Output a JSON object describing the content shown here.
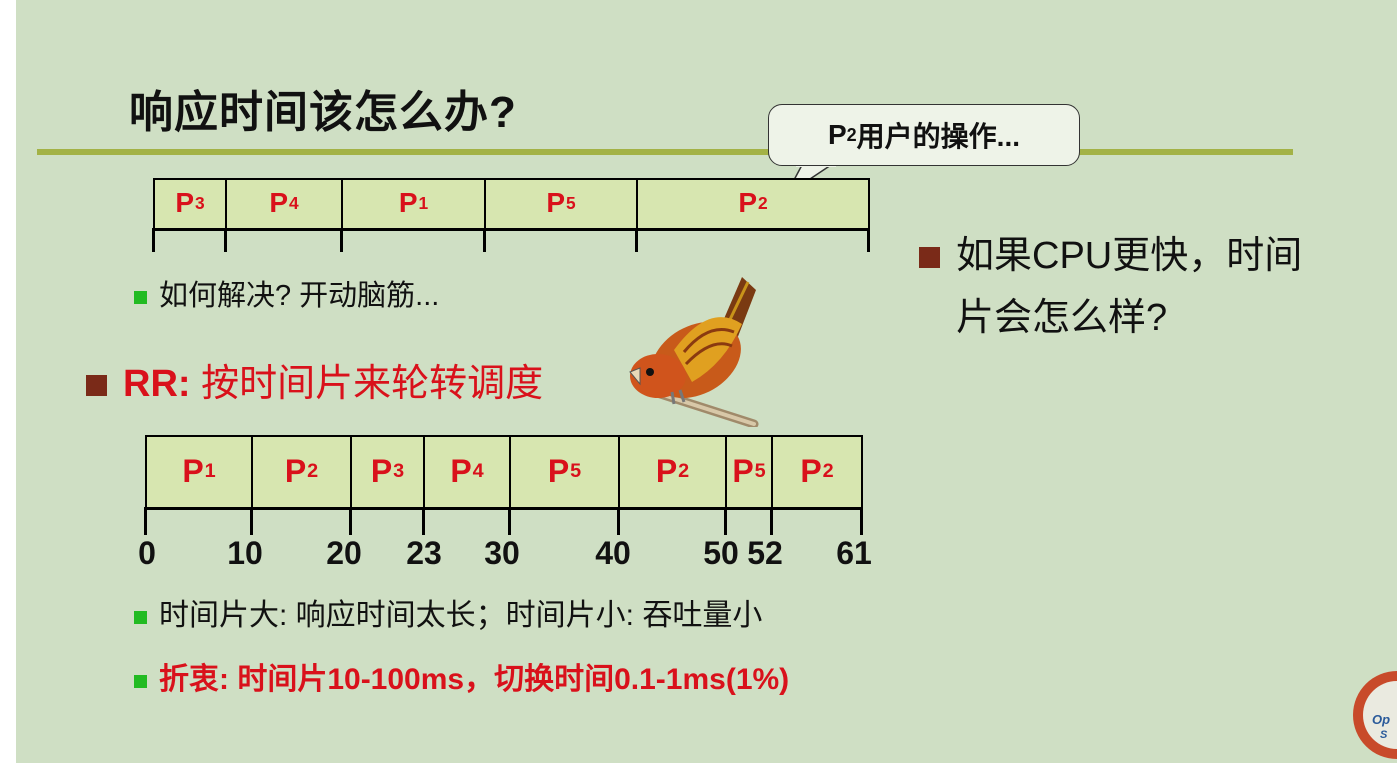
{
  "title": "响应时间该怎么办?",
  "callout": {
    "prefix": "P",
    "sub": "2",
    "suffix": "用户的操作..."
  },
  "gantt1": {
    "cells": [
      {
        "base": "P",
        "sub": "3"
      },
      {
        "base": "P",
        "sub": "4"
      },
      {
        "base": "P",
        "sub": "1"
      },
      {
        "base": "P",
        "sub": "5"
      },
      {
        "base": "P",
        "sub": "2"
      }
    ]
  },
  "bullet1": "如何解决? 开动脑筋...",
  "rr_heading": {
    "bold": "RR:",
    "rest": " 按时间片来轮转调度"
  },
  "gantt2": {
    "cells": [
      {
        "base": "P",
        "sub": "1"
      },
      {
        "base": "P",
        "sub": "2"
      },
      {
        "base": "P",
        "sub": "3"
      },
      {
        "base": "P",
        "sub": "4"
      },
      {
        "base": "P",
        "sub": "5"
      },
      {
        "base": "P",
        "sub": "2"
      },
      {
        "base": "P",
        "sub": "5"
      },
      {
        "base": "P",
        "sub": "2"
      }
    ],
    "times": [
      "0",
      "10",
      "20",
      "23",
      "30",
      "40",
      "50",
      "52",
      "61"
    ]
  },
  "bullet2": "时间片大: 响应时间太长；时间片小: 吞吐量小",
  "bullet3": "折衷: 时间片10-100ms，切换时间0.1-1ms(1%)",
  "right_text": {
    "line1": "如果CPU更快，时间",
    "line2": "片会怎么样?"
  },
  "colors": {
    "background": "#cfdfc4",
    "rule": "#a3b246",
    "cell_fill": "#d7e6b0",
    "process_text": "#d9111b",
    "green_bullet": "#22bb22",
    "brown_bullet": "#7a2a18"
  },
  "icons": {
    "bird": "bird-on-branch-illustration",
    "logo": "operating-system-logo"
  }
}
